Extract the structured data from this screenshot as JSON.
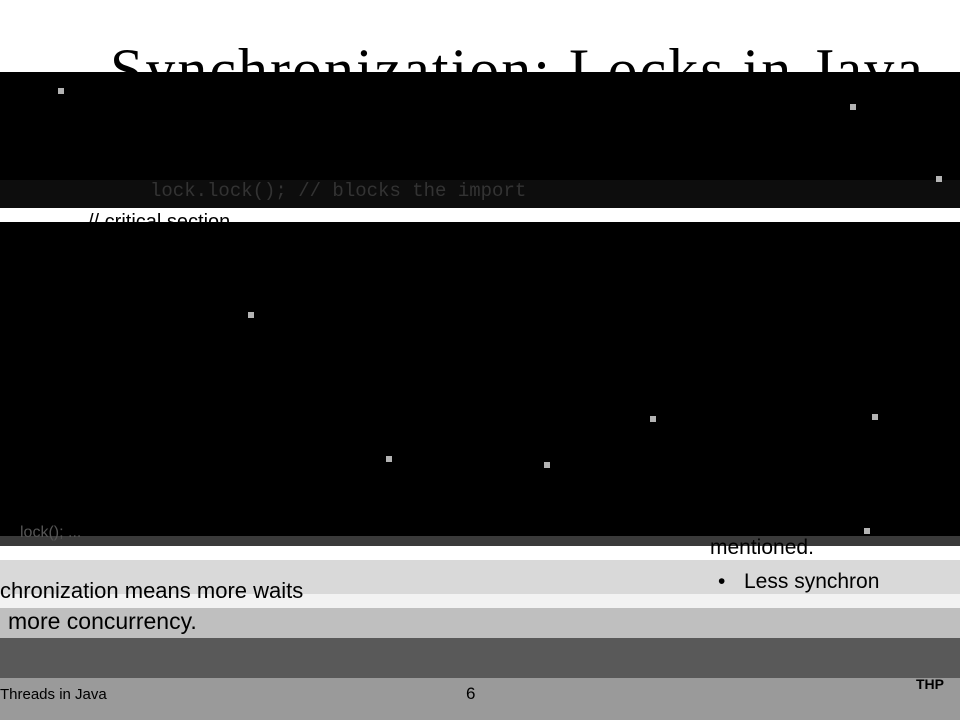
{
  "slide": {
    "title": "Synchronization: Locks in Java",
    "code": {
      "line1": "lock.lock();  // blocks the import",
      "comment": "// critical section"
    },
    "body": {
      "snippet": "lock(); ...",
      "mentioned": "mentioned.",
      "bullet_right": "Less synchron",
      "meaning": "chronization means more waits",
      "concurrency": "more concurrency."
    },
    "footer": {
      "left": "Threads in Java",
      "page": "6",
      "right": "THP"
    }
  },
  "colors": {
    "background": "#000000",
    "text": "#000000",
    "band_light": "#d9d9d9",
    "band_dark": "#595959"
  }
}
